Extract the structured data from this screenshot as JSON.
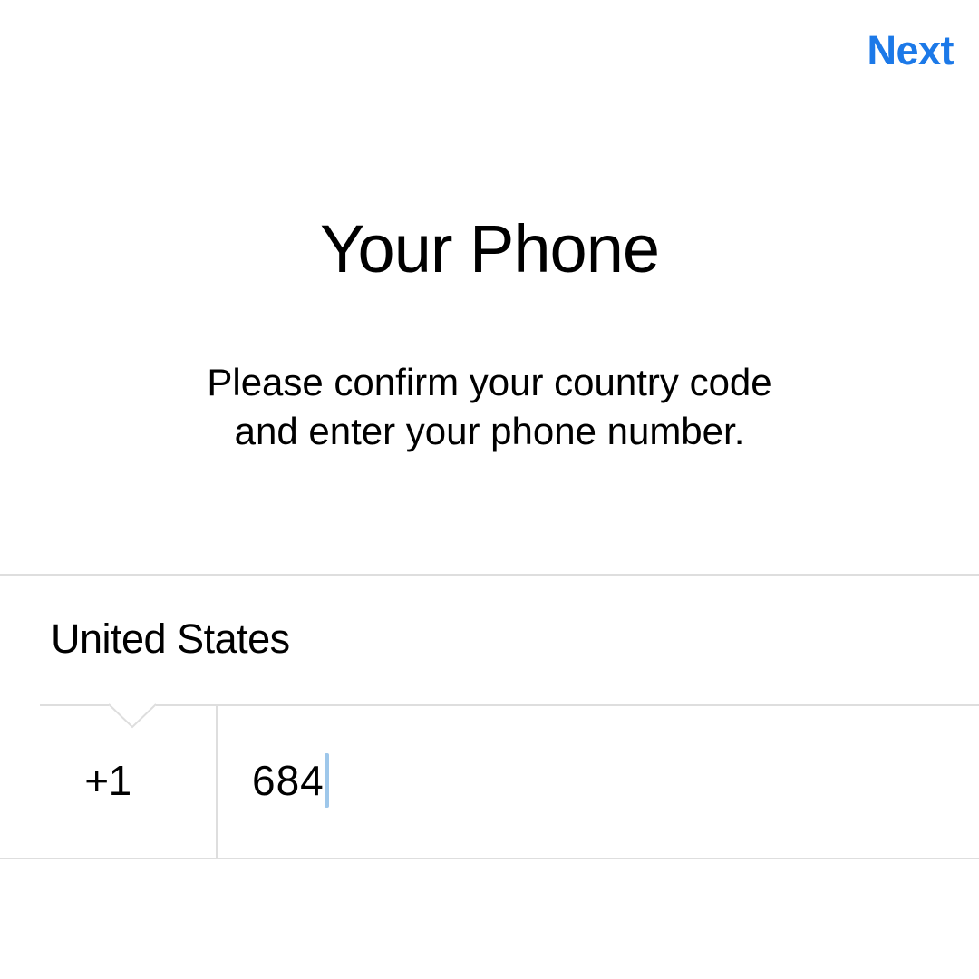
{
  "header": {
    "next_label": "Next"
  },
  "title": "Your Phone",
  "subtitle_line1": "Please confirm your country code",
  "subtitle_line2": "and enter your phone number.",
  "form": {
    "country": "United States",
    "country_code": "+1",
    "phone_value": "684"
  },
  "colors": {
    "accent": "#1c79e8",
    "divider": "#dedede",
    "caret": "#9ec7ea"
  }
}
